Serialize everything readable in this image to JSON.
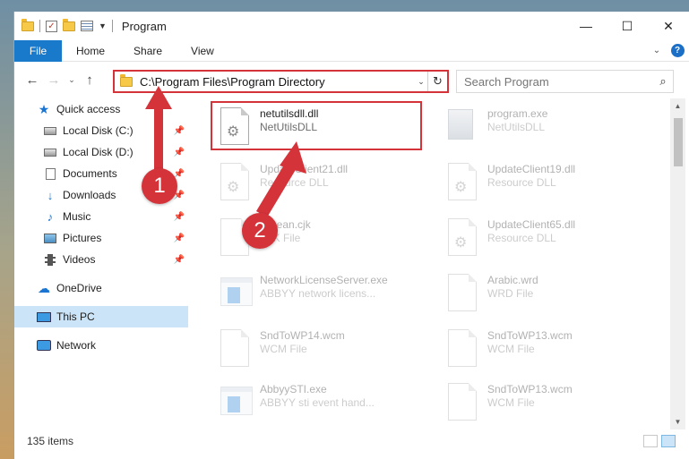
{
  "window": {
    "title": "Program",
    "controls": {
      "minimize": "—",
      "maximize": "☐",
      "close": "✕"
    }
  },
  "ribbon": {
    "file": "File",
    "tabs": [
      "Home",
      "Share",
      "View"
    ],
    "expand": "⌄",
    "help": "?"
  },
  "nav": {
    "back": "←",
    "forward": "→",
    "recent": "⌄",
    "up": "↑",
    "address": "C:\\Program Files\\Program Directory",
    "address_dropdown": "⌄",
    "refresh": "↻",
    "search_placeholder": "Search Program",
    "search_icon": "⌕"
  },
  "sidebar": {
    "quick_access": "Quick access",
    "pinned": [
      {
        "label": "Local Disk (C:)",
        "icon": "disk-icon"
      },
      {
        "label": "Local Disk (D:)",
        "icon": "disk-icon"
      },
      {
        "label": "Documents",
        "icon": "documents-icon"
      },
      {
        "label": "Downloads",
        "icon": "downloads-icon"
      },
      {
        "label": "Music",
        "icon": "music-icon"
      },
      {
        "label": "Pictures",
        "icon": "pictures-icon"
      },
      {
        "label": "Videos",
        "icon": "videos-icon"
      }
    ],
    "onedrive": "OneDrive",
    "this_pc": "This PC",
    "network": "Network"
  },
  "files": [
    {
      "name": "netutilsdll.dll",
      "desc": "NetUtilsDLL",
      "icon": "dll-icon",
      "highlighted": true
    },
    {
      "name": "program.exe",
      "desc": "NetUtilsDLL",
      "icon": "program-icon",
      "faded": true
    },
    {
      "name": "UpdateClient21.dll",
      "desc": "Resource DLL",
      "icon": "dll-icon",
      "faded": true
    },
    {
      "name": "UpdateClient19.dll",
      "desc": "Resource DLL",
      "icon": "dll-icon",
      "faded": true
    },
    {
      "name": "Korean.cjk",
      "desc": "CJK File",
      "icon": "file-icon",
      "faded": true
    },
    {
      "name": "UpdateClient65.dll",
      "desc": "Resource DLL",
      "icon": "dll-icon",
      "faded": true
    },
    {
      "name": "NetworkLicenseServer.exe",
      "desc": "ABBYY network licens...",
      "icon": "exe-icon",
      "faded": true
    },
    {
      "name": "Arabic.wrd",
      "desc": "WRD File",
      "icon": "file-icon",
      "faded": true
    },
    {
      "name": "SndToWP14.wcm",
      "desc": "WCM File",
      "icon": "file-icon",
      "faded": true
    },
    {
      "name": "SndToWP13.wcm",
      "desc": "WCM File",
      "icon": "file-icon",
      "faded": true
    },
    {
      "name": "AbbyySTI.exe",
      "desc": "ABBYY sti event hand...",
      "icon": "exe-icon",
      "faded": true
    },
    {
      "name": "SndToWP13.wcm",
      "desc": "WCM File",
      "icon": "file-icon",
      "faded": true
    }
  ],
  "status": {
    "item_count": "135 items"
  },
  "annotations": {
    "marker1": "1",
    "marker2": "2",
    "accent": "#d5333a"
  }
}
